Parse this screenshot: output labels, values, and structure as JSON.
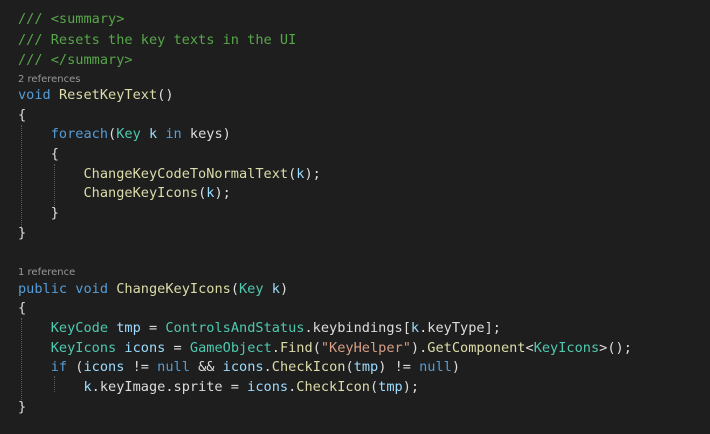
{
  "colors": {
    "background": "#1e1e1e",
    "comment": "#57a64a",
    "keyword": "#569cd6",
    "method": "#dcdcaa",
    "type": "#4ec9b0",
    "parameter": "#9cdcfe",
    "string": "#d69d85",
    "plain": "#dcdcdc",
    "codelens": "#999999"
  },
  "codelens": {
    "reset_key_text": "2 references",
    "change_key_icons": "1 reference"
  },
  "lines": [
    {
      "kind": "code",
      "tokens": [
        {
          "t": "/// <summary>",
          "c": "comment"
        }
      ]
    },
    {
      "kind": "code",
      "tokens": [
        {
          "t": "/// Resets the key texts in the UI",
          "c": "comment"
        }
      ]
    },
    {
      "kind": "code",
      "tokens": [
        {
          "t": "/// </summary>",
          "c": "comment"
        }
      ]
    },
    {
      "kind": "lens",
      "key": "reset_key_text"
    },
    {
      "kind": "code",
      "tokens": [
        {
          "t": "void",
          "c": "keyword"
        },
        {
          "t": " ",
          "c": "plain"
        },
        {
          "t": "ResetKeyText",
          "c": "method"
        },
        {
          "t": "()",
          "c": "plain"
        }
      ]
    },
    {
      "kind": "code",
      "tokens": [
        {
          "t": "{",
          "c": "plain"
        }
      ]
    },
    {
      "kind": "code",
      "tokens": [
        {
          "t": "    ",
          "c": "plain"
        },
        {
          "t": "foreach",
          "c": "keyword"
        },
        {
          "t": "(",
          "c": "plain"
        },
        {
          "t": "Key",
          "c": "type"
        },
        {
          "t": " ",
          "c": "plain"
        },
        {
          "t": "k",
          "c": "param"
        },
        {
          "t": " ",
          "c": "plain"
        },
        {
          "t": "in",
          "c": "keyword"
        },
        {
          "t": " keys)",
          "c": "plain"
        }
      ]
    },
    {
      "kind": "code",
      "tokens": [
        {
          "t": "    {",
          "c": "plain"
        }
      ]
    },
    {
      "kind": "code",
      "tokens": [
        {
          "t": "        ",
          "c": "plain"
        },
        {
          "t": "ChangeKeyCodeToNormalText",
          "c": "method"
        },
        {
          "t": "(",
          "c": "plain"
        },
        {
          "t": "k",
          "c": "param"
        },
        {
          "t": ");",
          "c": "plain"
        }
      ]
    },
    {
      "kind": "code",
      "tokens": [
        {
          "t": "        ",
          "c": "plain"
        },
        {
          "t": "ChangeKeyIcons",
          "c": "method"
        },
        {
          "t": "(",
          "c": "plain"
        },
        {
          "t": "k",
          "c": "param"
        },
        {
          "t": ");",
          "c": "plain"
        }
      ]
    },
    {
      "kind": "code",
      "tokens": [
        {
          "t": "    }",
          "c": "plain"
        }
      ]
    },
    {
      "kind": "code",
      "tokens": [
        {
          "t": "}",
          "c": "plain"
        }
      ]
    },
    {
      "kind": "blank"
    },
    {
      "kind": "lens",
      "key": "change_key_icons"
    },
    {
      "kind": "code",
      "tokens": [
        {
          "t": "public",
          "c": "keyword"
        },
        {
          "t": " ",
          "c": "plain"
        },
        {
          "t": "void",
          "c": "keyword"
        },
        {
          "t": " ",
          "c": "plain"
        },
        {
          "t": "ChangeKeyIcons",
          "c": "method"
        },
        {
          "t": "(",
          "c": "plain"
        },
        {
          "t": "Key",
          "c": "type"
        },
        {
          "t": " ",
          "c": "plain"
        },
        {
          "t": "k",
          "c": "param"
        },
        {
          "t": ")",
          "c": "plain"
        }
      ]
    },
    {
      "kind": "code",
      "tokens": [
        {
          "t": "{",
          "c": "plain"
        }
      ]
    },
    {
      "kind": "code",
      "tokens": [
        {
          "t": "    ",
          "c": "plain"
        },
        {
          "t": "KeyCode",
          "c": "type"
        },
        {
          "t": " ",
          "c": "plain"
        },
        {
          "t": "tmp",
          "c": "param"
        },
        {
          "t": " = ",
          "c": "plain"
        },
        {
          "t": "ControlsAndStatus",
          "c": "type"
        },
        {
          "t": ".keybindings[",
          "c": "plain"
        },
        {
          "t": "k",
          "c": "param"
        },
        {
          "t": ".keyType];",
          "c": "plain"
        }
      ]
    },
    {
      "kind": "code",
      "tokens": [
        {
          "t": "    ",
          "c": "plain"
        },
        {
          "t": "KeyIcons",
          "c": "type"
        },
        {
          "t": " ",
          "c": "plain"
        },
        {
          "t": "icons",
          "c": "param"
        },
        {
          "t": " = ",
          "c": "plain"
        },
        {
          "t": "GameObject",
          "c": "type"
        },
        {
          "t": ".",
          "c": "plain"
        },
        {
          "t": "Find",
          "c": "method"
        },
        {
          "t": "(",
          "c": "plain"
        },
        {
          "t": "\"KeyHelper\"",
          "c": "string"
        },
        {
          "t": ").",
          "c": "plain"
        },
        {
          "t": "GetComponent",
          "c": "method"
        },
        {
          "t": "<",
          "c": "plain"
        },
        {
          "t": "KeyIcons",
          "c": "type"
        },
        {
          "t": ">();",
          "c": "plain"
        }
      ]
    },
    {
      "kind": "code",
      "tokens": [
        {
          "t": "    ",
          "c": "plain"
        },
        {
          "t": "if",
          "c": "keyword"
        },
        {
          "t": " (",
          "c": "plain"
        },
        {
          "t": "icons",
          "c": "param"
        },
        {
          "t": " != ",
          "c": "plain"
        },
        {
          "t": "null",
          "c": "keyword"
        },
        {
          "t": " && ",
          "c": "plain"
        },
        {
          "t": "icons",
          "c": "param"
        },
        {
          "t": ".",
          "c": "plain"
        },
        {
          "t": "CheckIcon",
          "c": "method"
        },
        {
          "t": "(",
          "c": "plain"
        },
        {
          "t": "tmp",
          "c": "param"
        },
        {
          "t": ") != ",
          "c": "plain"
        },
        {
          "t": "null",
          "c": "keyword"
        },
        {
          "t": ")",
          "c": "plain"
        }
      ]
    },
    {
      "kind": "code",
      "tokens": [
        {
          "t": "        ",
          "c": "plain"
        },
        {
          "t": "k",
          "c": "param"
        },
        {
          "t": ".keyImage.sprite = ",
          "c": "plain"
        },
        {
          "t": "icons",
          "c": "param"
        },
        {
          "t": ".",
          "c": "plain"
        },
        {
          "t": "CheckIcon",
          "c": "method"
        },
        {
          "t": "(",
          "c": "plain"
        },
        {
          "t": "tmp",
          "c": "param"
        },
        {
          "t": ");",
          "c": "plain"
        }
      ]
    },
    {
      "kind": "code",
      "tokens": [
        {
          "t": "}",
          "c": "plain"
        }
      ]
    }
  ]
}
